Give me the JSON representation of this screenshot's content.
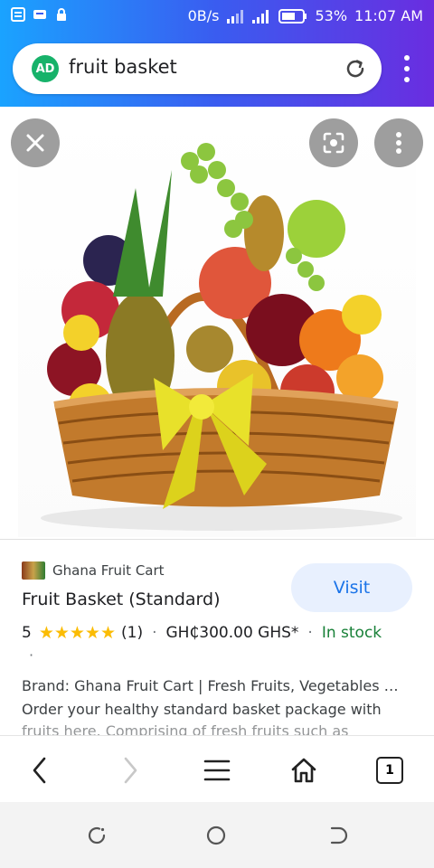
{
  "status_bar": {
    "speed": "0B/s",
    "battery": "53%",
    "time": "11:07 AM"
  },
  "search_bar": {
    "ad_badge": "AD",
    "query": "fruit basket"
  },
  "product": {
    "brand": "Ghana Fruit Cart",
    "visit_label": "Visit",
    "title": "Fruit Basket (Standard)",
    "rating": "5",
    "stars": "★★★★★",
    "review_count": "(1)",
    "price": "GH₵300.00 GHS*",
    "stock": "In stock",
    "separator": "·",
    "description_line1": "Brand: Ghana Fruit Cart | Fresh Fruits, Vegetables …",
    "description_line2": "Order your healthy standard basket package with",
    "description_line3": "fruits here. Comprising of fresh fruits such as"
  },
  "bottom_nav": {
    "tab_count": "1"
  }
}
